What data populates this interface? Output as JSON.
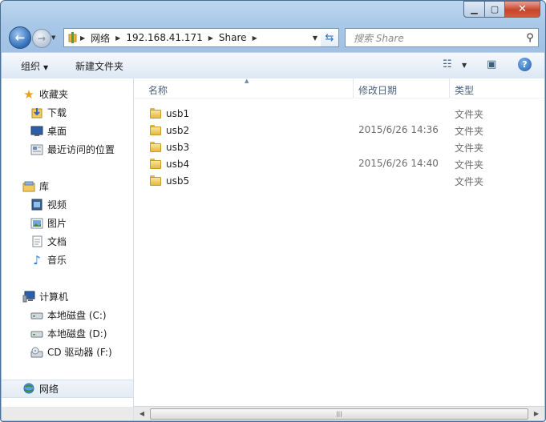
{
  "window": {
    "icons": {
      "minimize": "minimize-icon",
      "maximize": "maximize-icon",
      "close": "close-icon"
    }
  },
  "nav": {
    "breadcrumb": [
      "网络",
      "192.168.41.171",
      "Share"
    ],
    "search_placeholder": "搜索 Share"
  },
  "toolbar": {
    "organize": "组织",
    "new_folder": "新建文件夹"
  },
  "sidebar": {
    "favorites": {
      "label": "收藏夹",
      "items": [
        {
          "label": "下载",
          "icon": "downloads-icon"
        },
        {
          "label": "桌面",
          "icon": "desktop-icon"
        },
        {
          "label": "最近访问的位置",
          "icon": "recent-places-icon"
        }
      ]
    },
    "libraries": {
      "label": "库",
      "items": [
        {
          "label": "视频",
          "icon": "video-library-icon"
        },
        {
          "label": "图片",
          "icon": "pictures-library-icon"
        },
        {
          "label": "文档",
          "icon": "documents-library-icon"
        },
        {
          "label": "音乐",
          "icon": "music-library-icon"
        }
      ]
    },
    "computer": {
      "label": "计算机",
      "items": [
        {
          "label": "本地磁盘 (C:)",
          "icon": "hard-drive-icon"
        },
        {
          "label": "本地磁盘 (D:)",
          "icon": "hard-drive-icon"
        },
        {
          "label": "CD 驱动器 (F:)",
          "icon": "cd-drive-icon"
        }
      ]
    },
    "network": {
      "label": "网络"
    }
  },
  "columns": {
    "name": "名称",
    "date": "修改日期",
    "type": "类型"
  },
  "files": [
    {
      "name": "usb1",
      "date": "",
      "type": "文件夹"
    },
    {
      "name": "usb2",
      "date": "2015/6/26 14:36",
      "type": "文件夹"
    },
    {
      "name": "usb3",
      "date": "",
      "type": "文件夹"
    },
    {
      "name": "usb4",
      "date": "2015/6/26 14:40",
      "type": "文件夹"
    },
    {
      "name": "usb5",
      "date": "",
      "type": "文件夹"
    }
  ]
}
